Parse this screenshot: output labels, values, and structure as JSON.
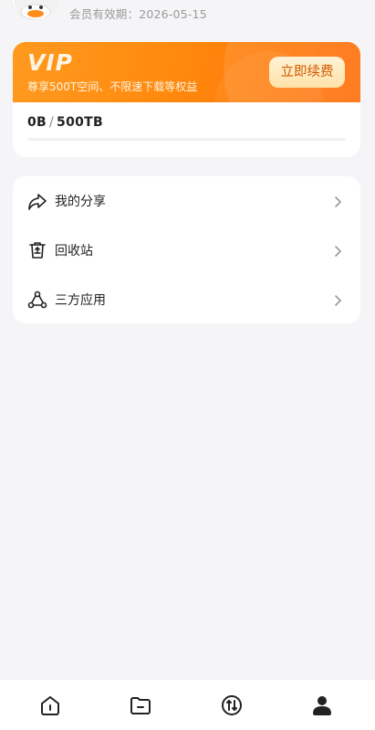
{
  "profile": {
    "expiry_text": "会员有效期：2026-05-15"
  },
  "vip": {
    "title": "VIP",
    "subtitle": "尊享500T空间、不限速下载等权益",
    "renew_label": "立即续费",
    "storage_used": "0B",
    "storage_separator": "/",
    "storage_total": "500TB",
    "storage_fraction": 0
  },
  "menu": {
    "items": [
      {
        "label": "我的分享",
        "icon": "share-icon"
      },
      {
        "label": "回收站",
        "icon": "trash-icon"
      },
      {
        "label": "三方应用",
        "icon": "third-party-apps-icon"
      }
    ]
  },
  "tabbar": {
    "tabs": [
      {
        "icon": "home-icon",
        "active": false
      },
      {
        "icon": "folder-icon",
        "active": false
      },
      {
        "icon": "transfer-icon",
        "active": false
      },
      {
        "icon": "profile-icon",
        "active": true
      }
    ]
  },
  "colors": {
    "accent": "#ff8a0e",
    "renew_text": "#d05a00",
    "background": "#f5f5f7"
  }
}
